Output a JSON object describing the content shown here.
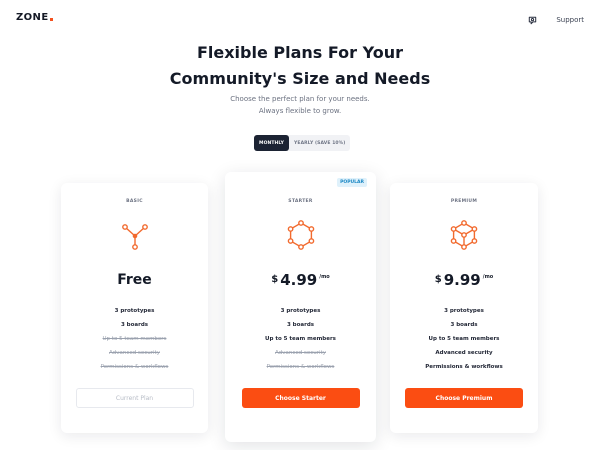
{
  "brand": {
    "name": "ZONE",
    "accent": "#fb4d12"
  },
  "nav": {
    "icon": "chat-search-icon",
    "support_label": "Support"
  },
  "hero": {
    "title_line1": "Flexible Plans For Your",
    "title_line2": "Community's Size and Needs",
    "subtitle_line1": "Choose the perfect plan for your needs.",
    "subtitle_line2": "Always flexible to grow."
  },
  "billing_toggle": {
    "monthly_label": "MONTHLY",
    "yearly_label": "YEARLY (SAVE 10%)",
    "selected": "MONTHLY"
  },
  "plans": [
    {
      "name": "BASIC",
      "icon": "triad-nodes-icon",
      "price_text": "Free",
      "features": [
        {
          "label": "3 prototypes",
          "included": true
        },
        {
          "label": "3 boards",
          "included": true
        },
        {
          "label": "Up to 5 team members",
          "included": false
        },
        {
          "label": "Advanced security",
          "included": false
        },
        {
          "label": "Permissions & workflows",
          "included": false
        }
      ],
      "cta_label": "Current Plan"
    },
    {
      "name": "STARTER",
      "badge": "POPULAR",
      "icon": "hexagon-nodes-icon",
      "currency": "$",
      "price": "4.99",
      "period": "/mo",
      "features": [
        {
          "label": "3 prototypes",
          "included": true
        },
        {
          "label": "3 boards",
          "included": true
        },
        {
          "label": "Up to 5 team members",
          "included": true
        },
        {
          "label": "Advanced security",
          "included": false
        },
        {
          "label": "Permissions & workflows",
          "included": false
        }
      ],
      "cta_label": "Choose Starter"
    },
    {
      "name": "PREMIUM",
      "icon": "cube-nodes-icon",
      "currency": "$",
      "price": "9.99",
      "period": "/mo",
      "features": [
        {
          "label": "3 prototypes",
          "included": true
        },
        {
          "label": "3 boards",
          "included": true
        },
        {
          "label": "Up to 5 team members",
          "included": true
        },
        {
          "label": "Advanced security",
          "included": true
        },
        {
          "label": "Permissions & workflows",
          "included": true
        }
      ],
      "cta_label": "Choose Premium"
    }
  ]
}
